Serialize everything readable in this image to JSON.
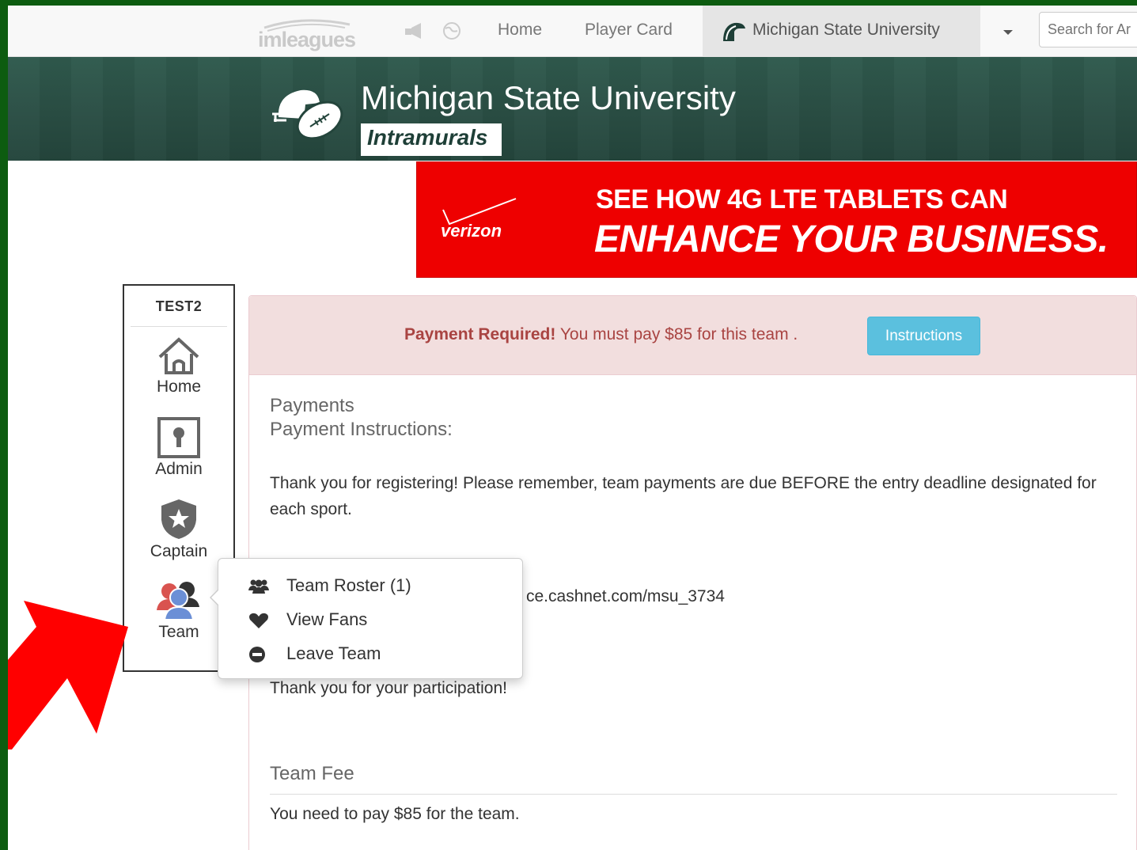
{
  "nav": {
    "logo": "imleagues",
    "links": [
      "Home",
      "Player Card"
    ],
    "active_school": "Michigan State University",
    "search_placeholder": "Search for Ar"
  },
  "header": {
    "school": "Michigan State University",
    "subtitle": "Intramurals"
  },
  "ad": {
    "brand": "verizon",
    "line1": "SEE HOW 4G LTE TABLETS CAN",
    "line2": "ENHANCE YOUR BUSINESS."
  },
  "sidebar": {
    "team_name": "TEST2",
    "items": [
      {
        "label": "Home",
        "icon": "home-icon"
      },
      {
        "label": "Admin",
        "icon": "keyhole-icon"
      },
      {
        "label": "Captain",
        "icon": "shield-star-icon"
      },
      {
        "label": "Team",
        "icon": "team-icon"
      }
    ]
  },
  "alert": {
    "strong": "Payment Required!",
    "text": " You must pay $85 for this team .",
    "button": "Instructions"
  },
  "payments": {
    "title": "Payments",
    "subtitle": "Payment Instructions:",
    "body": "Thank you for registering! Please remember, team payments are due BEFORE the entry deadline designated for each sport.",
    "link_fragment": "ce.cashnet.com/msu_3734",
    "thanks": "Thank you for your participation!",
    "fee_title": "Team Fee",
    "fee_text": "You need to pay $85 for the team."
  },
  "popover": {
    "items": [
      {
        "label": "Team Roster (1)",
        "icon": "users-icon"
      },
      {
        "label": "View Fans",
        "icon": "heart-icon"
      },
      {
        "label": "Leave Team",
        "icon": "minus-circle-icon"
      }
    ]
  },
  "colors": {
    "frame_border": "#0d5c10",
    "header_bg": "#2a4e44",
    "ad_red": "#ee0000",
    "alert_text": "#a94442",
    "alert_bg": "#f2dede",
    "info_button": "#5bc0de",
    "annotation_arrow": "#ff0000"
  }
}
